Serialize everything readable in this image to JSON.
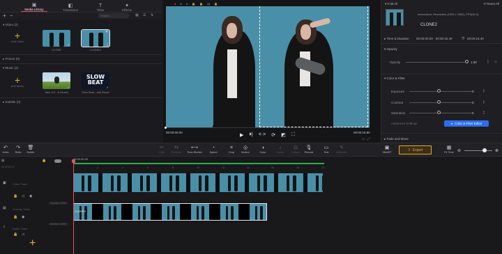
{
  "tabs": [
    {
      "label": "Media Library",
      "icon": "media-icon"
    },
    {
      "label": "Transitions",
      "icon": "transitions-icon"
    },
    {
      "label": "Titles",
      "icon": "titles-icon"
    },
    {
      "label": "Effects",
      "icon": "effects-icon"
    }
  ],
  "media": {
    "search_placeholder": "Search...",
    "video_section": "Video (2)",
    "video_add": "Add Video",
    "video_items": [
      {
        "name": "CLONE"
      },
      {
        "name": "CLONE2"
      }
    ],
    "picture_section": "Picture (0)",
    "music_section": "Music (2)",
    "music_add": "Add Music",
    "music_items": [
      {
        "name": "Take It E...ft.Music)"
      },
      {
        "name": "Slow Beat...and Music"
      }
    ],
    "music_thumb_text": "SLOW BEAT",
    "subtitle_section": "Subtitle (0)"
  },
  "preview": {
    "time_current": "00:00:00.00",
    "time_total": "00:00:15.80"
  },
  "props": {
    "fold_all": "Fold All",
    "reset_all": "Reset All",
    "info": "Information: Resolution (1920 x 1080), FPS(30.0)",
    "clip_name": "CLONE2",
    "time_section": "Time & Duration",
    "time_range": "00:00:00.00 - 00:00:15.40",
    "duration": "00:00:15.40",
    "opacity_section": "Opacity",
    "opacity_label": "Opacity",
    "opacity_value": "1.00",
    "color_section": "Color & Filter",
    "exposure_label": "Exposure",
    "exposure_value": "0",
    "contrast_label": "Contrast",
    "contrast_value": "0",
    "saturation_label": "Saturation",
    "saturation_value": "0",
    "advanced": "Advanced Settings",
    "editor_btn": "Color & Filter Editor",
    "fade_section": "Fade and Move"
  },
  "toolbar": {
    "left": [
      {
        "label": "Undo",
        "icon": "undo-icon"
      },
      {
        "label": "Redo",
        "icon": "redo-icon"
      },
      {
        "label": "Delete",
        "icon": "delete-icon"
      }
    ],
    "center": [
      {
        "label": "Split",
        "icon": "split-icon"
      },
      {
        "label": "Reverse",
        "icon": "reverse-icon"
      },
      {
        "label": "Time-Stretch",
        "icon": "time-stretch-icon"
      },
      {
        "label": "Speed",
        "icon": "speed-icon"
      },
      {
        "label": "Crop",
        "icon": "crop-icon"
      },
      {
        "label": "Motion",
        "icon": "motion-icon"
      },
      {
        "label": "Color",
        "icon": "color-icon"
      },
      {
        "label": "Audio",
        "icon": "audio-icon"
      },
      {
        "label": "Detach",
        "icon": "detach-icon"
      },
      {
        "label": "Record",
        "icon": "record-icon"
      },
      {
        "label": "Text",
        "icon": "text-icon"
      },
      {
        "label": "Annotate",
        "icon": "annotate-icon"
      }
    ],
    "smart": "SMART",
    "export": "Export",
    "fit": "Fit Time"
  },
  "timeline": {
    "ruler_start": "00:00:00.00",
    "top_time": "00:00:00.00",
    "ticks": [
      "00:00:00.00",
      "2",
      "4",
      "6",
      "8",
      "10",
      "12",
      "14",
      "16",
      "18",
      "20"
    ],
    "video_track": "Video Track",
    "overlay_track": "Overlay Track",
    "audio_track": "Audio Track",
    "opacity_badge": "Opacity: 100%",
    "volume_badge": "Volume: 100%",
    "clip_label": "CLONE2"
  },
  "colors": {
    "accent": "#e94d61",
    "export": "#e9a82d",
    "blue": "#2d6df0",
    "teal": "#4a8fa8"
  }
}
